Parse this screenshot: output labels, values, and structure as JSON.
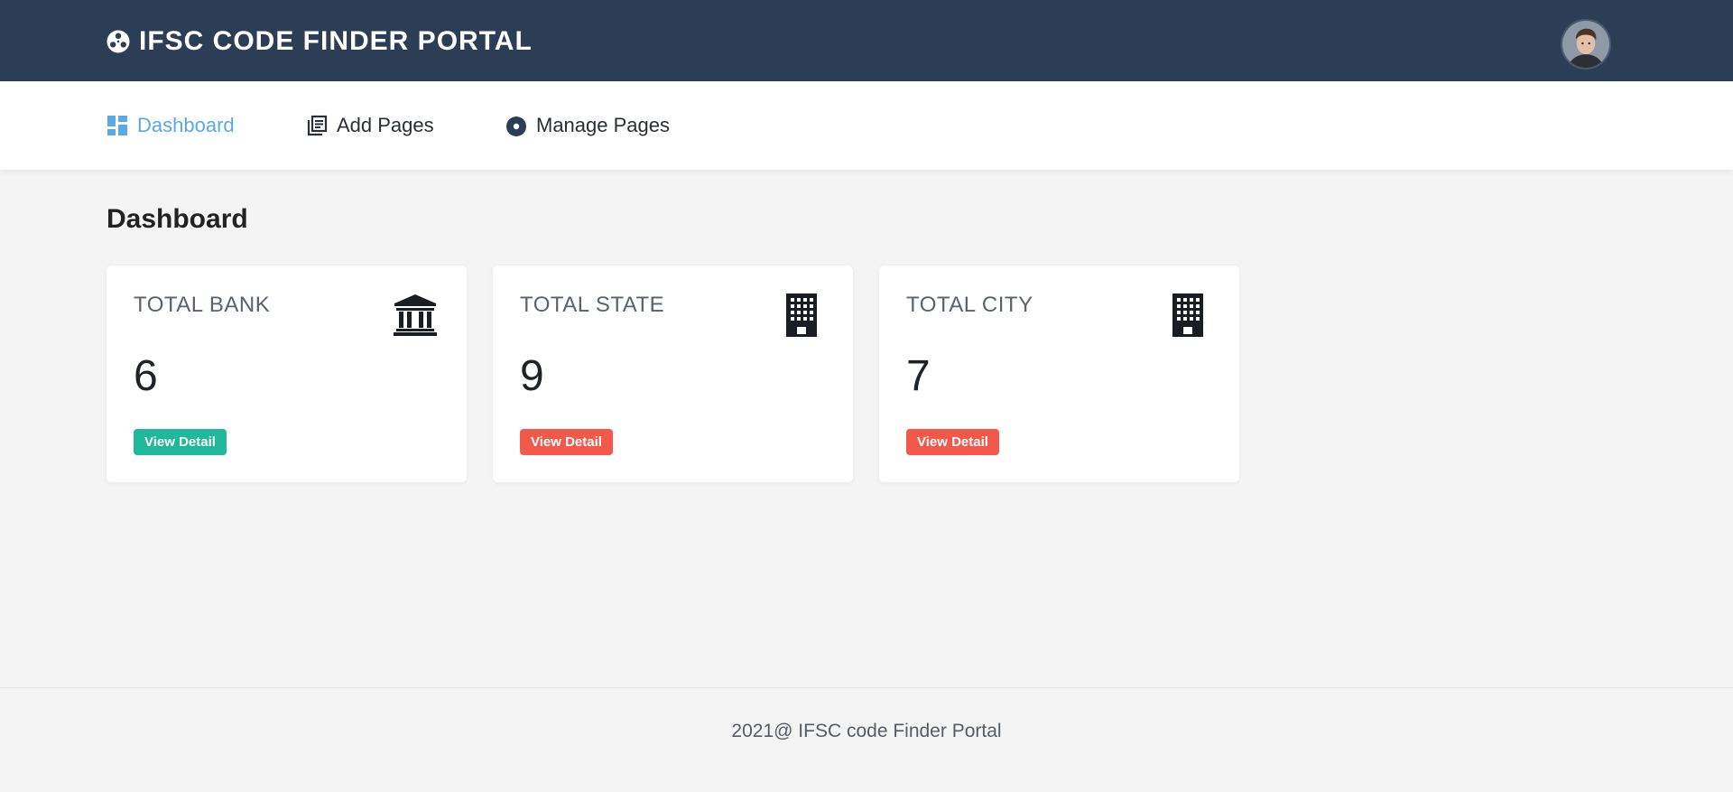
{
  "header": {
    "title": "IFSC CODE FINDER PORTAL",
    "logo_icon": "film-reel-icon",
    "avatar_icon": "user-avatar",
    "background_color": "#2c3e55"
  },
  "nav": {
    "items": [
      {
        "label": "Dashboard",
        "icon": "dashboard-icon",
        "active": true
      },
      {
        "label": "Add Pages",
        "icon": "pages-icon",
        "active": false
      },
      {
        "label": "Manage Pages",
        "icon": "record-icon",
        "active": false
      }
    ],
    "active_color": "#5aa9e6"
  },
  "main": {
    "title": "Dashboard",
    "cards": [
      {
        "label": "TOTAL BANK",
        "value": "6",
        "icon": "bank-icon",
        "button_label": "View Detail",
        "button_color": "#1fb899"
      },
      {
        "label": "TOTAL STATE",
        "value": "9",
        "icon": "building-icon",
        "button_label": "View Detail",
        "button_color": "#f2594b"
      },
      {
        "label": "TOTAL CITY",
        "value": "7",
        "icon": "building-icon",
        "button_label": "View Detail",
        "button_color": "#f2594b"
      }
    ]
  },
  "footer": {
    "text": "2021@ IFSC code Finder Portal"
  }
}
